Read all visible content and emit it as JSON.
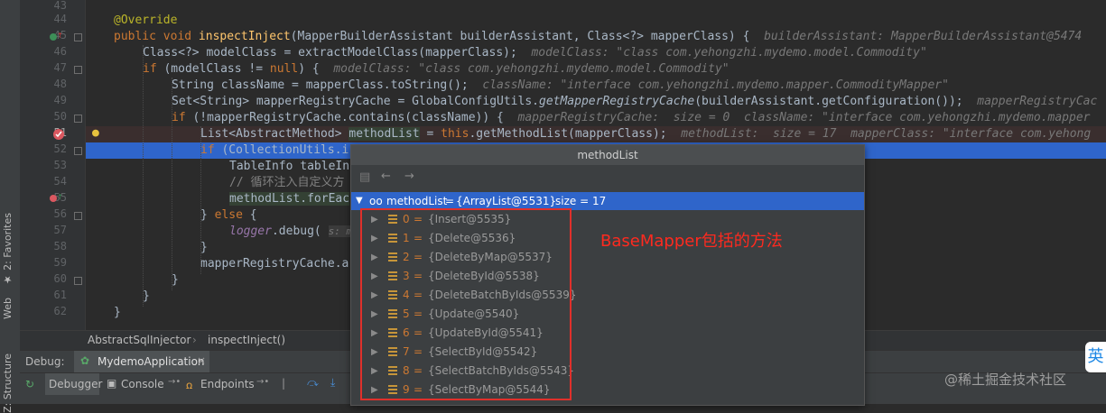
{
  "left_strip": {
    "tab_favorites": "2: Favorites",
    "tab_web": "Web",
    "tab_structure": "Z: Structure"
  },
  "gutter": {
    "line_numbers": [
      "43",
      "44",
      "45",
      "46",
      "47",
      "48",
      "49",
      "50",
      "51",
      "52",
      "53",
      "54",
      "55",
      "56",
      "57",
      "58",
      "59",
      "60",
      "61",
      "62"
    ]
  },
  "code": {
    "l44": {
      "annotation": "@Override"
    },
    "l45": {
      "kw1": "public void ",
      "fn": "inspectInject",
      "rest": "(MapperBuilderAssistant builderAssistant, Class<?> mapperClass) {",
      "hint": "builderAssistant: MapperBuilderAssistant@5474"
    },
    "l46": {
      "code": "Class<?> modelClass = extractModelClass(mapperClass);",
      "hint": "modelClass: \"class com.yehongzhi.mydemo.model.Commodity\""
    },
    "l47": {
      "kw": "if",
      "code": " (modelClass != ",
      "kw2": "null",
      "code2": ") {",
      "hint": "modelClass: \"class com.yehongzhi.mydemo.model.Commodity\""
    },
    "l48": {
      "code": "String className = mapperClass.toString();",
      "hint": "className: \"interface com.yehongzhi.mydemo.mapper.CommodityMapper\""
    },
    "l49": {
      "code1": "Set<String> mapperRegistryCache = GlobalConfigUtils.",
      "method": "getMapperRegistryCache",
      "code2": "(builderAssistant.getConfiguration());",
      "hint": "mapperRegistryCac"
    },
    "l50": {
      "kw": "if",
      "code": " (!mapperRegistryCache.contains(className)) {",
      "hint": "mapperRegistryCache:  size = 0  className: \"interface com.yehongzhi.mydemo.mapper"
    },
    "l51": {
      "code1": "List<AbstractMethod> ",
      "var": "methodList",
      "code2": " = ",
      "kw": "this",
      "code3": ".getMethodList(mapperClass);",
      "hint": "methodList:  size = 17  mapperClass: \"interface com.yehong"
    },
    "l52": {
      "kw": "if",
      "code": " (CollectionUtils.i"
    },
    "l53": {
      "code": "TableInfo tableIn"
    },
    "l54": {
      "comment": "// 循环注入自定义方"
    },
    "l55": {
      "code": "methodList.forEac"
    },
    "l56": {
      "code1": "} ",
      "kw": "else",
      "code2": " {"
    },
    "l57": {
      "logger": "logger",
      "code": ".debug(",
      "hint": "s: m"
    },
    "l58": {
      "code": "}"
    },
    "l59": {
      "code": "mapperRegistryCache.a"
    },
    "l60": {
      "code": "}"
    },
    "l61": {
      "code": "}"
    },
    "l62": {
      "code": "}"
    }
  },
  "breadcrumb": {
    "class": "AbstractSqlInjector",
    "method": "inspectInject()"
  },
  "debug": {
    "label": "Debug:",
    "config": "MydemoApplication",
    "tab_debugger": "Debugger",
    "tab_console": "Console",
    "tab_endpoints": "Endpoints"
  },
  "popup": {
    "title": "methodList",
    "root": {
      "name": "methodList",
      "value": "{ArrayList@5531}",
      "size": "size = 17"
    },
    "items": [
      {
        "index": "0",
        "value": "{Insert@5535}"
      },
      {
        "index": "1",
        "value": "{Delete@5536}"
      },
      {
        "index": "2",
        "value": "{DeleteByMap@5537}"
      },
      {
        "index": "3",
        "value": "{DeleteById@5538}"
      },
      {
        "index": "4",
        "value": "{DeleteBatchByIds@5539}"
      },
      {
        "index": "5",
        "value": "{Update@5540}"
      },
      {
        "index": "6",
        "value": "{UpdateById@5541}"
      },
      {
        "index": "7",
        "value": "{SelectById@5542}"
      },
      {
        "index": "8",
        "value": "{SelectBatchByIds@5543}"
      },
      {
        "index": "9",
        "value": "{SelectByMap@5544}"
      }
    ]
  },
  "annotation_text": "BaseMapper包括的方法",
  "watermark": "@稀土掘金技术社区",
  "badge": "英",
  "colors": {
    "keyword": "#cc7832",
    "method": "#ffc66d",
    "selection": "#2f65ca",
    "red_box": "#e0302b",
    "background": "#2b2b2b"
  }
}
